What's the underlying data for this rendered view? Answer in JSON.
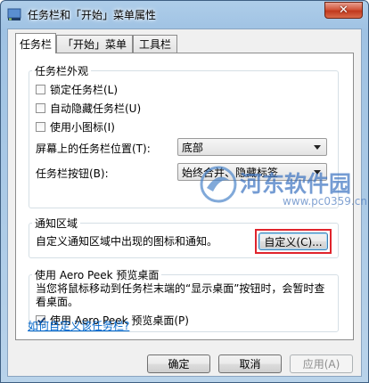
{
  "window": {
    "title": "任务栏和「开始」菜单属性",
    "close_symbol": "✕"
  },
  "tabs": [
    {
      "label": "任务栏",
      "active": true
    },
    {
      "label": "「开始」菜单",
      "active": false
    },
    {
      "label": "工具栏",
      "active": false
    }
  ],
  "appearance": {
    "group_label": "任务栏外观",
    "checkboxes": [
      {
        "label": "锁定任务栏(L)",
        "checked": false
      },
      {
        "label": "自动隐藏任务栏(U)",
        "checked": false
      },
      {
        "label": "使用小图标(I)",
        "checked": false
      }
    ],
    "position_label": "屏幕上的任务栏位置(T):",
    "position_value": "底部",
    "buttons_label": "任务栏按钮(B):",
    "buttons_value": "始终合并、隐藏标签"
  },
  "notify": {
    "group_label": "通知区域",
    "description": "自定义通知区域中出现的图标和通知。",
    "customize_button": "自定义(C)..."
  },
  "aero": {
    "group_label": "使用 Aero Peek 预览桌面",
    "description": "当您将鼠标移动到任务栏末端的“显示桌面”按钮时，会暂时查看桌面。",
    "checkbox_label": "使用 Aero Peek 预览桌面(P)",
    "checkbox_checked": true
  },
  "help_link": "如何自定义该任务栏?",
  "footer": {
    "ok": "确定",
    "cancel": "取消",
    "apply": "应用(A)"
  },
  "watermark": {
    "title": "河东软件园",
    "sub": "www.pc0359.cn"
  },
  "colors": {
    "highlight": "#e0242c",
    "link": "#0066cc",
    "close": "#c0391d"
  }
}
